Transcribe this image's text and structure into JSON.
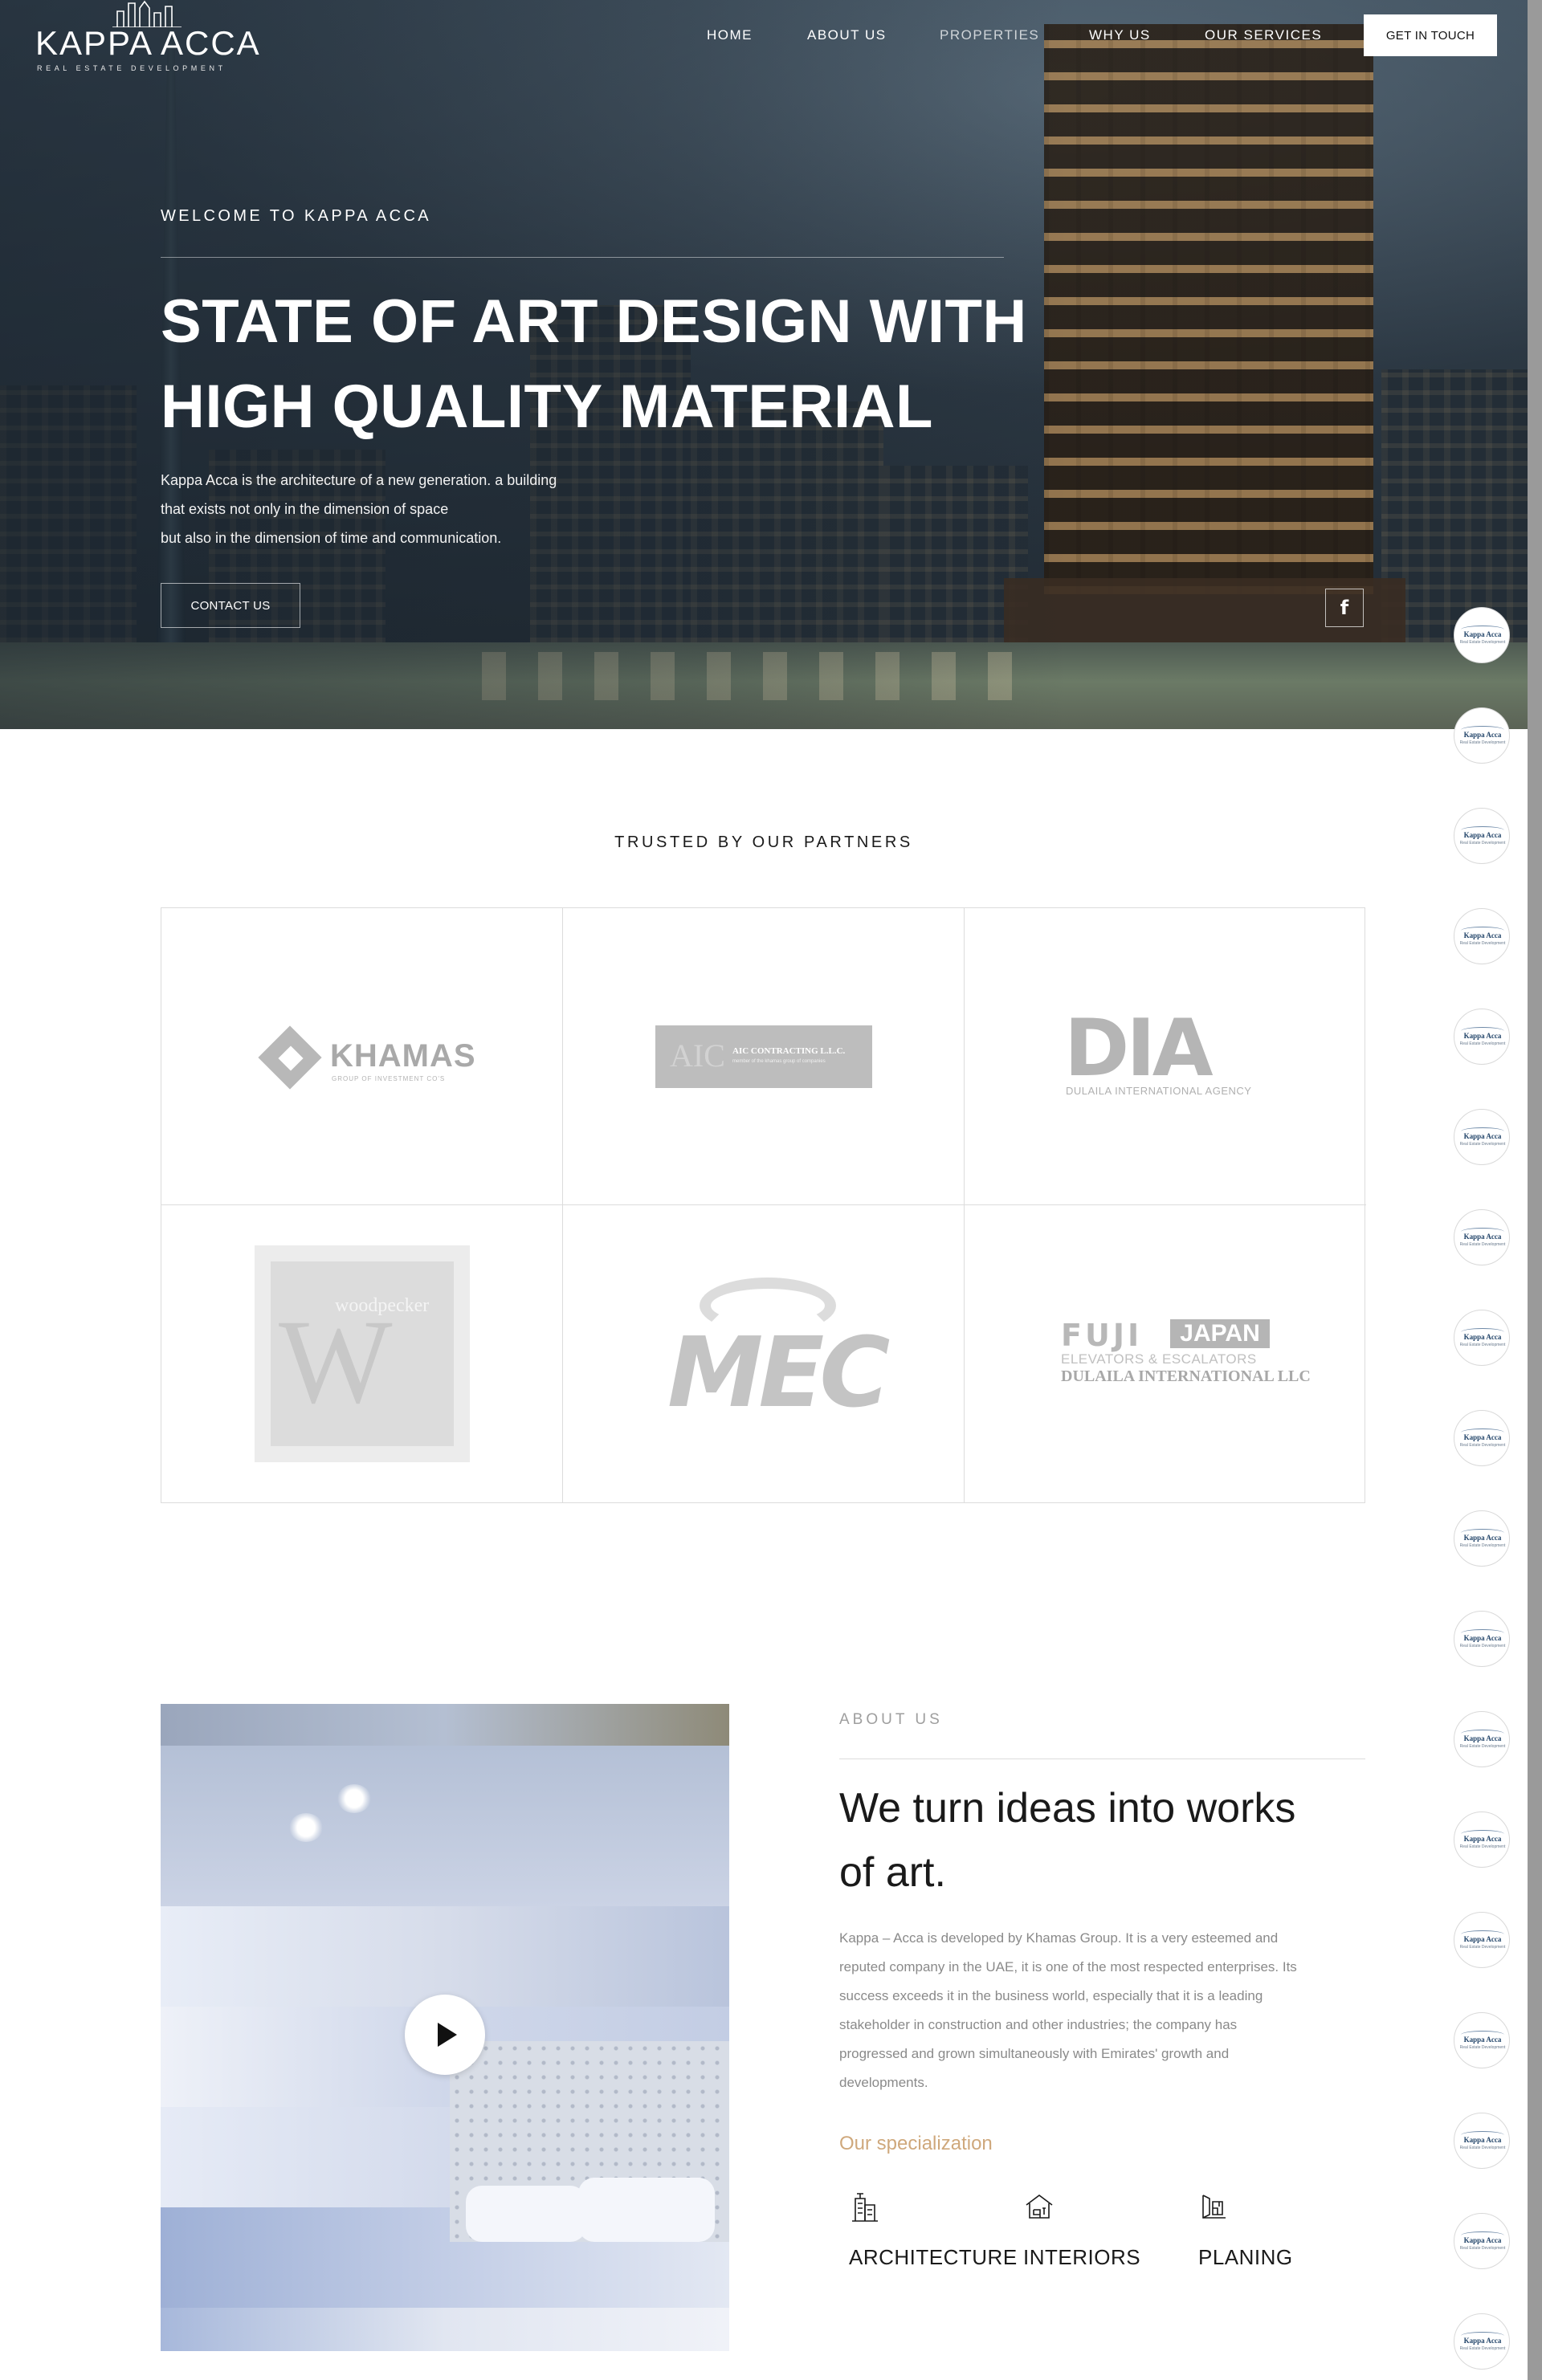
{
  "brand": {
    "name": "KAPPA ACCA",
    "tagline": "REAL ESTATE DEVELOPMENT"
  },
  "nav": {
    "items": [
      {
        "label": "HOME"
      },
      {
        "label": "ABOUT US"
      },
      {
        "label": "PROPERTIES"
      },
      {
        "label": "WHY US"
      },
      {
        "label": "OUR SERVICES"
      }
    ],
    "cta_label": "GET IN TOUCH"
  },
  "hero": {
    "kicker": "WELCOME TO KAPPA ACCA",
    "title_line1": "STATE OF ART DESIGN WITH",
    "title_line2": "HIGH QUALITY MATERIAL",
    "desc_line1": "Kappa Acca is the architecture of a new generation. a building",
    "desc_line2": "that exists not only in the dimension of space",
    "desc_line3": "but also in the dimension of time and communication.",
    "button_label": "CONTACT US",
    "social_icon": "facebook-icon"
  },
  "partners": {
    "title": "TRUSTED BY OUR PARTNERS",
    "logos": [
      {
        "name": "KHAMAS",
        "subtitle": "GROUP OF INVESTMENT CO'S"
      },
      {
        "name": "AIC",
        "subtitle": "AIC CONTRACTING L.L.C.",
        "note": "member of the khamas group of companies"
      },
      {
        "name": "DIA",
        "subtitle": "DULAILA INTERNATIONAL AGENCY"
      },
      {
        "name": "woodpecker",
        "subtitle": ""
      },
      {
        "name": "MEC",
        "subtitle": ""
      },
      {
        "name": "FUJI",
        "badge": "JAPAN",
        "line2": "ELEVATORS & ESCALATORS",
        "line3": "DULAILA INTERNATIONAL LLC"
      }
    ]
  },
  "watermark": {
    "text": "Kappa Acca",
    "sub": "Real Estate Development",
    "count": 18
  },
  "about": {
    "kicker": "ABOUT US",
    "title_line1": "We turn ideas into works",
    "title_line2": "of art.",
    "body_lines": [
      "Kappa – Acca is developed by Khamas Group. It is a very esteemed and",
      "reputed company in the UAE, it is one of the most respected enterprises. Its",
      "success exceeds it in the business world, especially that it is a leading",
      "stakeholder in construction and other industries; the company has",
      "progressed and grown simultaneously with Emirates' growth and",
      "developments."
    ],
    "spec_title": "Our specialization",
    "specs": [
      {
        "label": "ARCHITECTURE",
        "icon": "building-icon"
      },
      {
        "label": "INTERIORS",
        "icon": "house-icon"
      },
      {
        "label": "PLANING",
        "icon": "blueprint-icon"
      }
    ],
    "video_icon": "play-icon"
  },
  "colors": {
    "accent": "#cfa87c",
    "hero_overlay": "#2f3c48",
    "grid_border": "#dcdcdc",
    "body_text": "#8a8a8a"
  }
}
